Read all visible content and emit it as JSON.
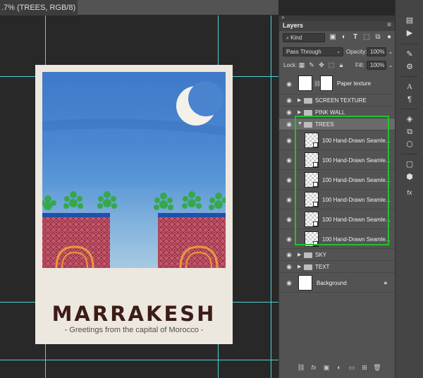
{
  "document_tab": {
    "title": ".7% (TREES, RGB/8) *",
    "close_label": "×"
  },
  "layers_panel": {
    "title": "Layers",
    "menu_icon": "hamburger-menu-icon",
    "filter": {
      "value": "Kind",
      "icon": "search-icon"
    },
    "blend_mode": "Pass Through",
    "opacity": {
      "label": "Opacity:",
      "value": "100%"
    },
    "lock_label": "Lock:",
    "fill": {
      "label": "Fill:",
      "value": "100%"
    },
    "layers": [
      {
        "name": "Paper texture",
        "type": "layer-with-mask",
        "visible": true
      },
      {
        "name": "SCREEN TEXTURE",
        "type": "group",
        "expanded": false,
        "visible": true
      },
      {
        "name": "PINK WALL",
        "type": "group",
        "expanded": false,
        "visible": true
      },
      {
        "name": "TREES",
        "type": "group",
        "expanded": true,
        "selected": true,
        "visible": true
      },
      {
        "name": "100 Hand-Drawn Seamle...",
        "type": "smart-object",
        "indent": 1,
        "visible": true
      },
      {
        "name": "100 Hand-Drawn Seamle...",
        "type": "smart-object",
        "indent": 1,
        "visible": true
      },
      {
        "name": "100 Hand-Drawn Seamle...",
        "type": "smart-object",
        "indent": 1,
        "visible": true
      },
      {
        "name": "100 Hand-Drawn Seamle...",
        "type": "smart-object",
        "indent": 1,
        "visible": true
      },
      {
        "name": "100 Hand-Drawn Seamle...",
        "type": "smart-object",
        "indent": 1,
        "visible": true
      },
      {
        "name": "100 Hand-Drawn Seamle...",
        "type": "smart-object",
        "indent": 1,
        "visible": true
      },
      {
        "name": "SKY",
        "type": "group",
        "expanded": false,
        "visible": true
      },
      {
        "name": "TEXT",
        "type": "group",
        "expanded": false,
        "visible": true
      },
      {
        "name": "Background",
        "type": "background",
        "locked": true,
        "visible": true
      }
    ],
    "highlight_color": "#22c02d"
  },
  "poster": {
    "title": "MARRAKESH",
    "subtitle": "- Greetings from the capital of Morocco -",
    "colors": {
      "sky": "#4a86d1",
      "wall": "#c9566b",
      "tree": "#35a84b",
      "paper": "#ede8df",
      "title": "#3d1c17"
    }
  }
}
